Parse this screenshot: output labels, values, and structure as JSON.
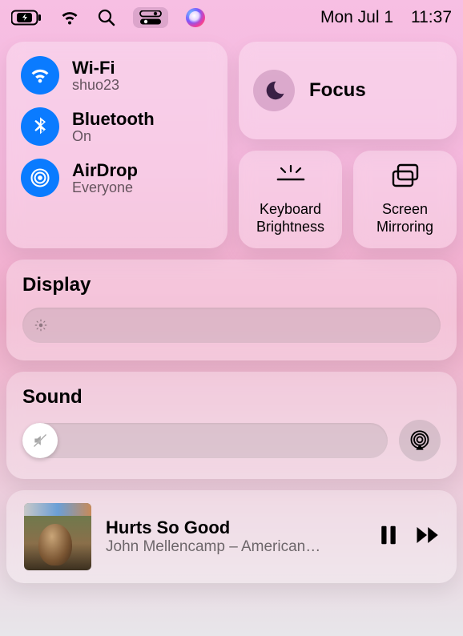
{
  "menubar": {
    "date": "Mon Jul 1",
    "time": "11:37"
  },
  "conn": {
    "wifi": {
      "title": "Wi-Fi",
      "subtitle": "shuo23"
    },
    "bluetooth": {
      "title": "Bluetooth",
      "subtitle": "On"
    },
    "airdrop": {
      "title": "AirDrop",
      "subtitle": "Everyone"
    }
  },
  "focus": {
    "label": "Focus"
  },
  "tiles": {
    "keyboard_brightness": "Keyboard\nBrightness",
    "screen_mirroring": "Screen\nMirroring"
  },
  "display": {
    "header": "Display"
  },
  "sound": {
    "header": "Sound"
  },
  "media": {
    "title": "Hurts So Good",
    "subtitle": "John Mellencamp – American…"
  }
}
